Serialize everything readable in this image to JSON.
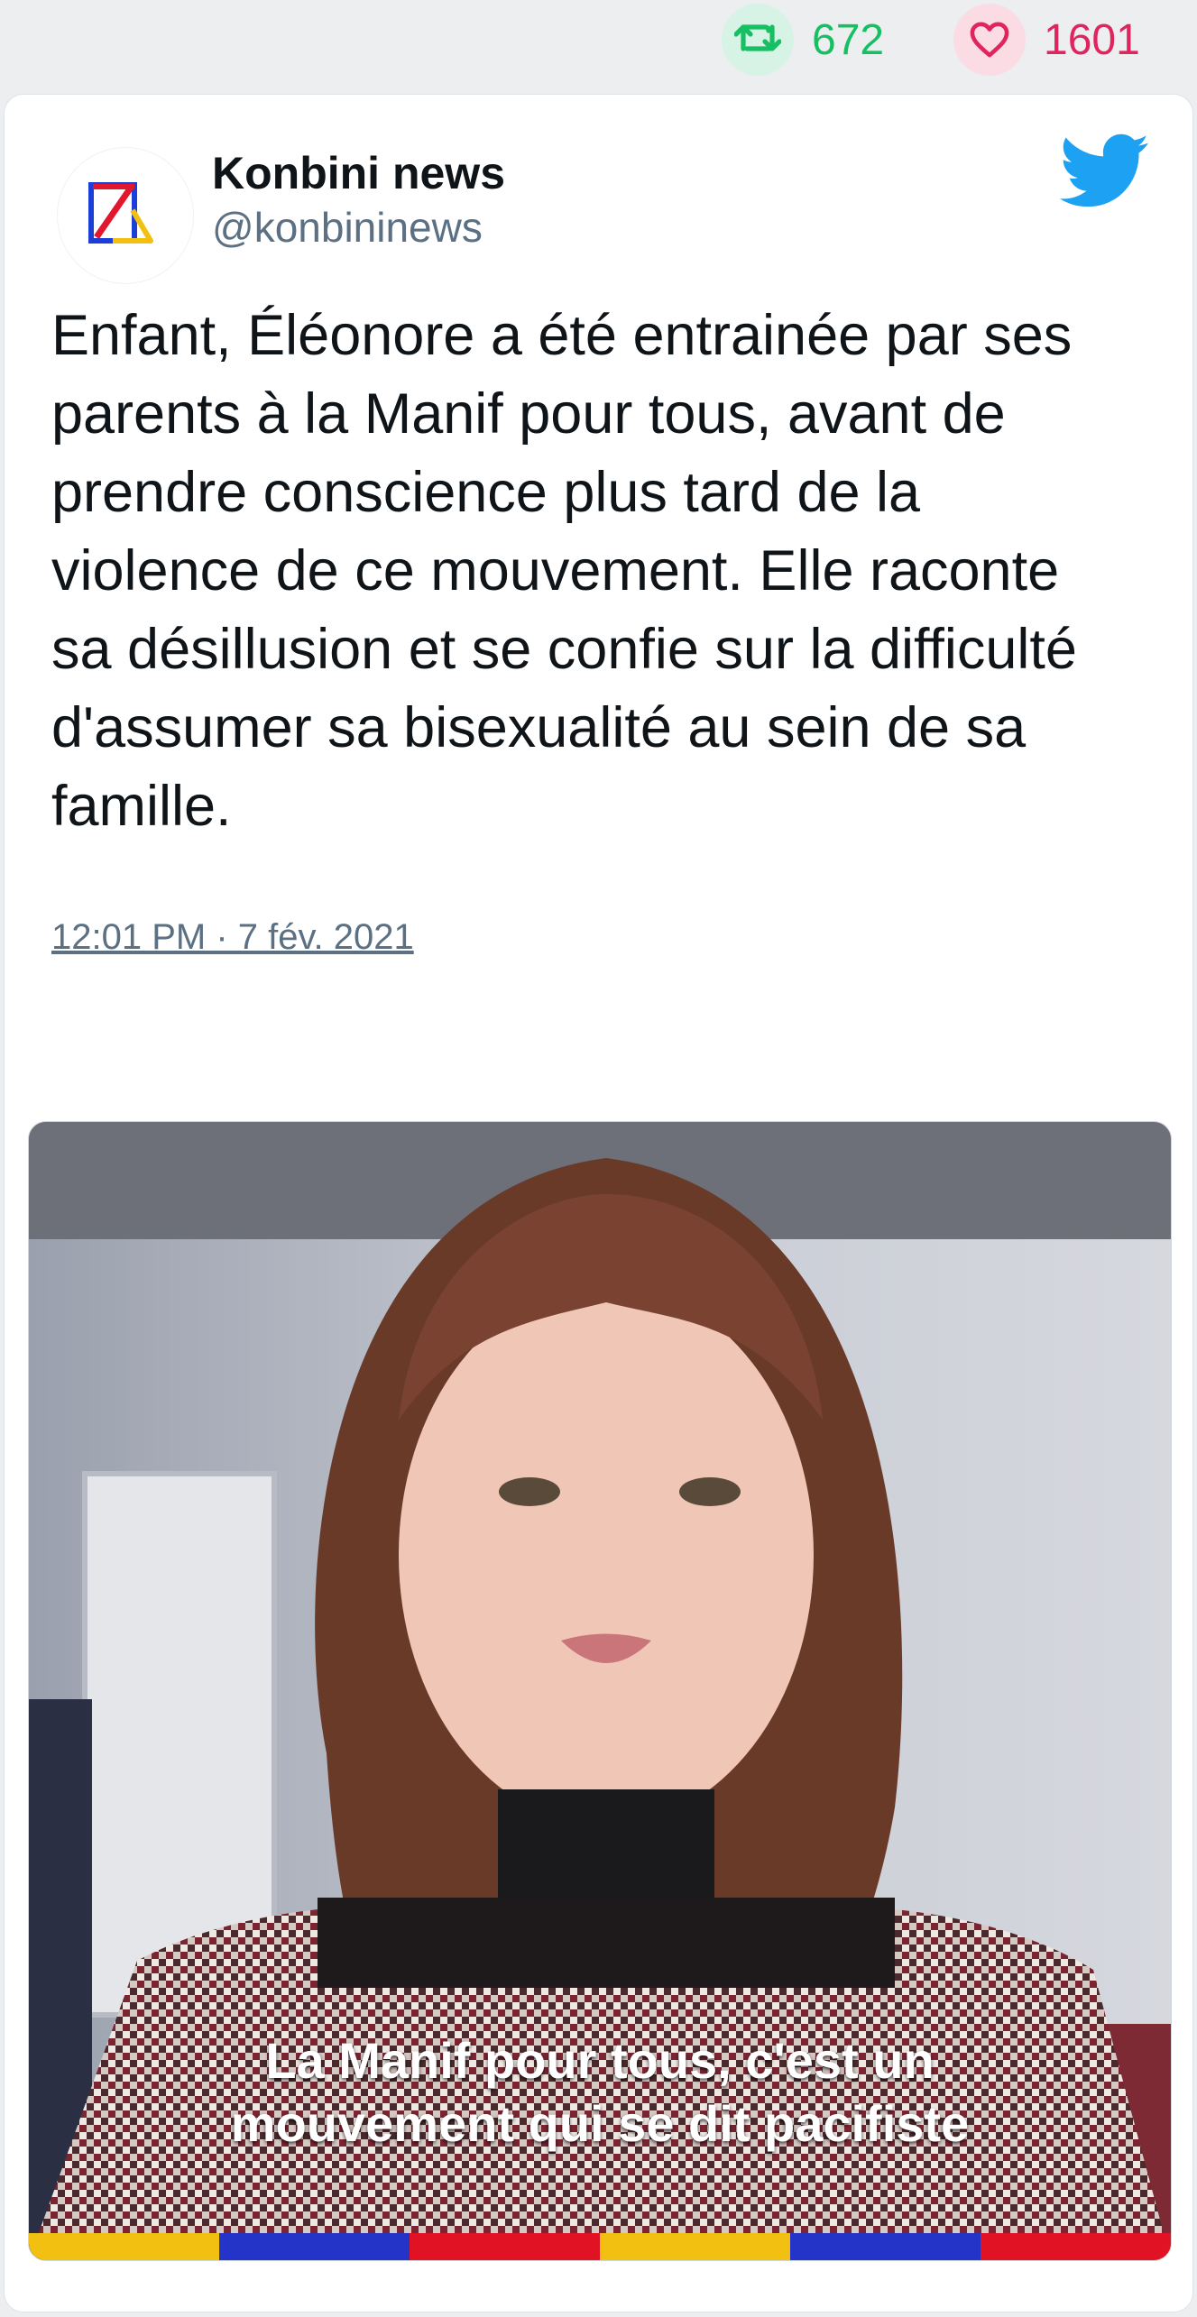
{
  "stats": {
    "retweets": "672",
    "likes": "1601"
  },
  "tweet": {
    "author_name": "Konbini news",
    "author_handle": "@konbininews",
    "text": "Enfant, Éléonore a été entrainée par ses\nparents à la Manif pour tous, avant de\nprendre conscience plus tard de la\nviolence de ce mouvement. Elle raconte\nsa désillusion et se confie sur la difficulté\nd'assumer sa bisexualité au sein de sa\nfamille.",
    "timestamp": "12:01 PM · 7 fév. 2021"
  },
  "media": {
    "caption_line1": "La Manif pour tous, c'est un",
    "caption_line2": "mouvement qui se dit pacifiste",
    "stripe_colors": [
      "#f2c011",
      "#2434c8",
      "#e21225",
      "#f2c011",
      "#2434c8",
      "#e21225"
    ]
  },
  "colors": {
    "retweet_green": "#17bf63",
    "like_pink": "#e0245e",
    "twitter_blue": "#1da1f2",
    "muted_text": "#5b7083"
  },
  "icons": [
    "retweet-icon",
    "heart-icon",
    "twitter-bird-icon",
    "reply-icon",
    "konbini-logo-icon"
  ]
}
